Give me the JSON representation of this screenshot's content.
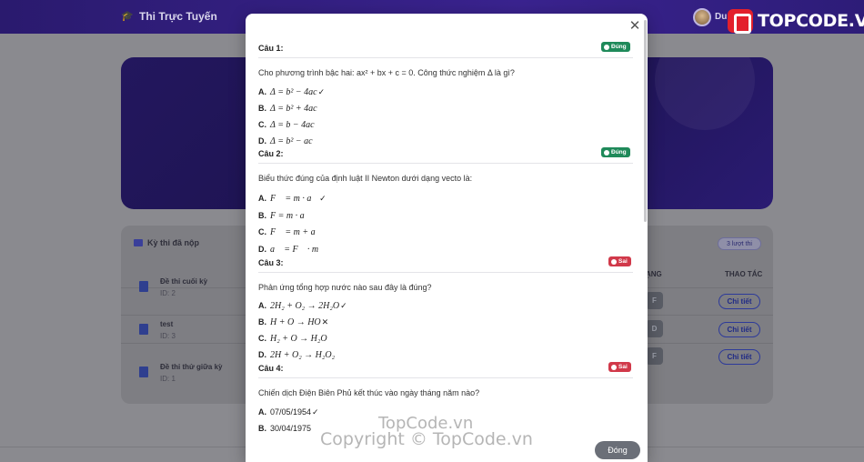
{
  "header": {
    "brand": "Thi Trực Tuyến",
    "user_name": "Du"
  },
  "logo": {
    "text": "TOPCODE.VN"
  },
  "exams": {
    "title": "Kỳ thi đã nộp",
    "count": "3 lượt thi",
    "col_grade": "ẠNG",
    "col_action": "THAO TÁC",
    "rows": [
      {
        "title": "Đề thi cuối kỳ",
        "id": "ID: 2",
        "grade": "F",
        "action": "Chi tiết"
      },
      {
        "title": "test",
        "id": "ID: 3",
        "grade": "D",
        "action": "Chi tiết"
      },
      {
        "title": "Đề thi thử giữa kỳ",
        "id": "ID: 1",
        "grade": "F",
        "action": "Chi tiết"
      }
    ]
  },
  "modal": {
    "close_label": "Đóng",
    "questions": [
      {
        "label": "Câu 1:",
        "status": "Đúng",
        "text": "Cho phương trình bậc hai: ax² + bx + c = 0. Công thức nghiệm Δ là gì?",
        "options": [
          {
            "letter": "A.",
            "text": "Δ = b² − 4ac",
            "mark": "✓"
          },
          {
            "letter": "B.",
            "text": "Δ = b² + 4ac",
            "mark": ""
          },
          {
            "letter": "C.",
            "text": "Δ = b − 4ac",
            "mark": ""
          },
          {
            "letter": "D.",
            "text": "Δ = b² − ac",
            "mark": ""
          }
        ]
      },
      {
        "label": "Câu 2:",
        "status": "Đúng",
        "text": "Biểu thức đúng của định luật II Newton dưới dạng vecto là:",
        "options": [
          {
            "letter": "A.",
            "text": "F⃗ = m · a⃗",
            "mark": "✓"
          },
          {
            "letter": "B.",
            "text": "F = m · a",
            "mark": ""
          },
          {
            "letter": "C.",
            "text": "F⃗ = m + a⃗",
            "mark": ""
          },
          {
            "letter": "D.",
            "text": "a⃗ = F⃗ · m",
            "mark": ""
          }
        ]
      },
      {
        "label": "Câu 3:",
        "status": "Sai",
        "text": "Phản ứng tổng hợp nước nào sau đây là đúng?",
        "options": [
          {
            "letter": "A.",
            "text": "2H₂ + O₂ → 2H₂O",
            "mark": "✓"
          },
          {
            "letter": "B.",
            "text": "H + O → HO",
            "mark": "✕"
          },
          {
            "letter": "C.",
            "text": "H₂ + O → H₂O",
            "mark": ""
          },
          {
            "letter": "D.",
            "text": "2H + O₂ → H₂O₂",
            "mark": ""
          }
        ]
      },
      {
        "label": "Câu 4:",
        "status": "Sai",
        "text": "Chiến dịch Điện Biên Phủ kết thúc vào ngày tháng năm nào?",
        "options": [
          {
            "letter": "A.",
            "text": "07/05/1954",
            "mark": "✓"
          },
          {
            "letter": "B.",
            "text": "30/04/1975",
            "mark": ""
          }
        ]
      }
    ]
  },
  "watermark": {
    "line1": "TopCode.vn",
    "line2": "Copyright © TopCode.vn"
  }
}
